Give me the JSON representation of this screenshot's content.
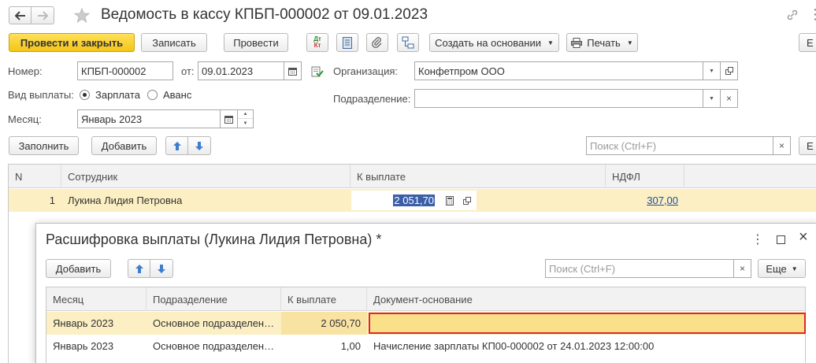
{
  "window": {
    "title": "Ведомость в кассу КПБП-000002 от 09.01.2023"
  },
  "toolbar": {
    "post_close": "Провести и закрыть",
    "save": "Записать",
    "post": "Провести",
    "dt_kt": "Дт",
    "dt_kt2": "Кт",
    "create_based": "Создать на основании",
    "print": "Печать",
    "more": "Е"
  },
  "form": {
    "number_label": "Номер:",
    "number_value": "КПБП-000002",
    "date_label": "от:",
    "date_value": "09.01.2023",
    "org_label": "Организация:",
    "org_value": "Конфетпром ООО",
    "payment_type_label": "Вид выплаты:",
    "payment_salary": "Зарплата",
    "payment_advance": "Аванс",
    "division_label": "Подразделение:",
    "division_value": "",
    "month_label": "Месяц:",
    "month_value": "Январь 2023"
  },
  "table_toolbar": {
    "fill": "Заполнить",
    "add": "Добавить",
    "search_placeholder": "Поиск (Ctrl+F)",
    "more": "Е"
  },
  "main_table": {
    "headers": [
      "N",
      "Сотрудник",
      "К выплате",
      "НДФЛ"
    ],
    "rows": [
      {
        "n": "1",
        "employee": "Лукина Лидия Петровна",
        "to_pay": "2 051,70",
        "ndfl": "307,00"
      }
    ]
  },
  "dialog": {
    "title": "Расшифровка выплаты (Лукина Лидия Петровна) *",
    "add": "Добавить",
    "search_placeholder": "Поиск (Ctrl+F)",
    "more": "Еще",
    "headers": [
      "Месяц",
      "Подразделение",
      "К выплате",
      "Документ-основание"
    ],
    "rows": [
      {
        "month": "Январь 2023",
        "division": "Основное подразделен…",
        "to_pay": "2 050,70",
        "doc": ""
      },
      {
        "month": "Январь 2023",
        "division": "Основное подразделен…",
        "to_pay": "1,00",
        "doc": "Начисление зарплаты КП00-000002 от 24.01.2023 12:00:00"
      }
    ]
  }
}
